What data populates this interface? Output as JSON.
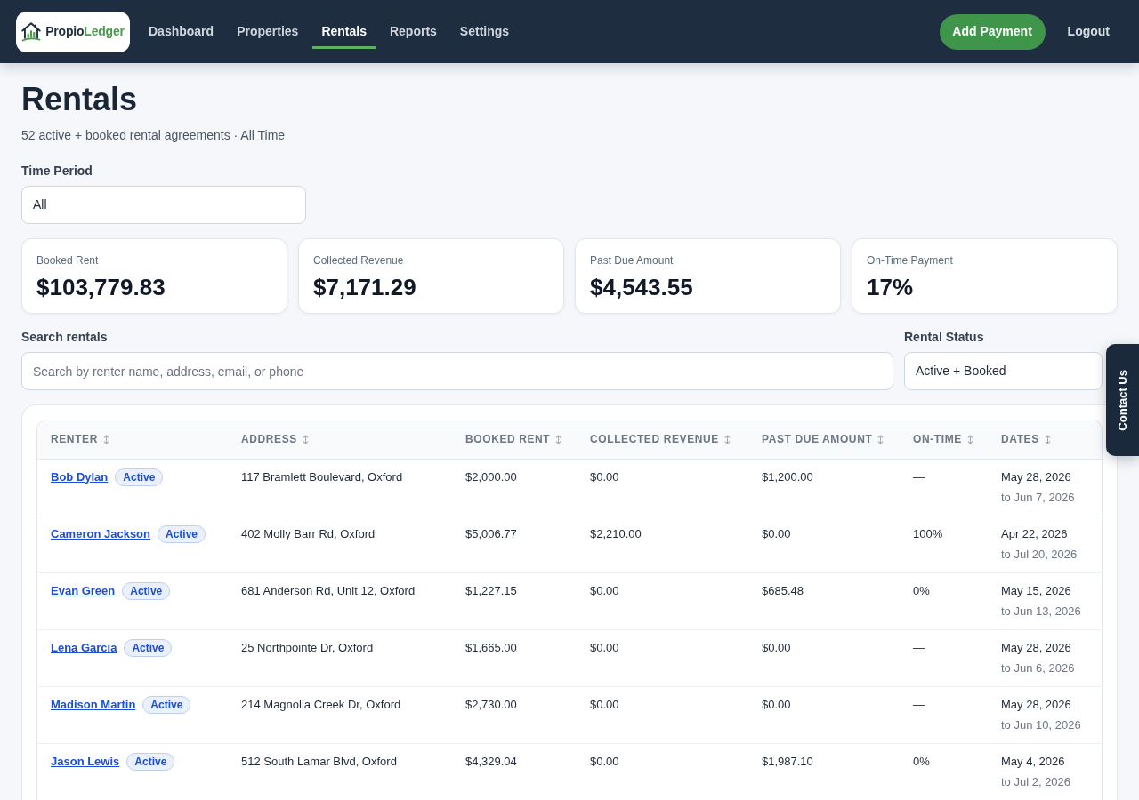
{
  "brand": {
    "name_parts": [
      {
        "text": "Propio",
        "color": "#1f2d3d"
      },
      {
        "text": "Ledger",
        "color": "#4b9b4f"
      }
    ]
  },
  "nav": {
    "items": [
      {
        "label": "Dashboard",
        "selected": false
      },
      {
        "label": "Properties",
        "selected": false
      },
      {
        "label": "Rentals",
        "selected": true
      },
      {
        "label": "Reports",
        "selected": false
      },
      {
        "label": "Settings",
        "selected": false
      }
    ],
    "add_payment_button": "Add Payment",
    "logout": "Logout"
  },
  "page": {
    "title": "Rentals",
    "subtitle": "52 active + booked rental agreements · All Time"
  },
  "time_period": {
    "label": "Time Period",
    "value": "All"
  },
  "stats": [
    {
      "label": "Booked Rent",
      "value": "$103,779.83"
    },
    {
      "label": "Collected Revenue",
      "value": "$7,171.29"
    },
    {
      "label": "Past Due Amount",
      "value": "$4,543.55"
    },
    {
      "label": "On-Time Payment",
      "value": "17%"
    }
  ],
  "search": {
    "label": "Search rentals",
    "placeholder": "Search by renter name, address, email, or phone"
  },
  "rental_status": {
    "label": "Rental Status",
    "value": "Active + Booked"
  },
  "table": {
    "columns": [
      {
        "label": "RENTER"
      },
      {
        "label": "ADDRESS"
      },
      {
        "label": "BOOKED RENT"
      },
      {
        "label": "COLLECTED REVENUE"
      },
      {
        "label": "PAST DUE AMOUNT"
      },
      {
        "label": "ON-TIME"
      },
      {
        "label": "DATES"
      }
    ],
    "rows": [
      {
        "renter": "Bob Dylan",
        "status": "Active",
        "address": "117 Bramlett Boulevard, Oxford",
        "booked_rent": "$2,000.00",
        "collected_revenue": "$0.00",
        "past_due_amount": "$1,200.00",
        "on_time": "—",
        "date_start": "May 28, 2026",
        "date_end": "to Jun 7, 2026"
      },
      {
        "renter": "Cameron Jackson",
        "status": "Active",
        "address": "402 Molly Barr Rd, Oxford",
        "booked_rent": "$5,006.77",
        "collected_revenue": "$2,210.00",
        "past_due_amount": "$0.00",
        "on_time": "100%",
        "date_start": "Apr 22, 2026",
        "date_end": "to Jul 20, 2026"
      },
      {
        "renter": "Evan Green",
        "status": "Active",
        "address": "681 Anderson Rd, Unit 12, Oxford",
        "booked_rent": "$1,227.15",
        "collected_revenue": "$0.00",
        "past_due_amount": "$685.48",
        "on_time": "0%",
        "date_start": "May 15, 2026",
        "date_end": "to Jun 13, 2026"
      },
      {
        "renter": "Lena Garcia",
        "status": "Active",
        "address": "25 Northpointe Dr, Oxford",
        "booked_rent": "$1,665.00",
        "collected_revenue": "$0.00",
        "past_due_amount": "$0.00",
        "on_time": "—",
        "date_start": "May 28, 2026",
        "date_end": "to Jun 6, 2026"
      },
      {
        "renter": "Madison Martin",
        "status": "Active",
        "address": "214 Magnolia Creek Dr, Oxford",
        "booked_rent": "$2,730.00",
        "collected_revenue": "$0.00",
        "past_due_amount": "$0.00",
        "on_time": "—",
        "date_start": "May 28, 2026",
        "date_end": "to Jun 10, 2026"
      },
      {
        "renter": "Jason Lewis",
        "status": "Active",
        "address": "512 South Lamar Blvd, Oxford",
        "booked_rent": "$4,329.04",
        "collected_revenue": "$0.00",
        "past_due_amount": "$1,987.10",
        "on_time": "0%",
        "date_start": "May 4, 2026",
        "date_end": "to Jul 2, 2026"
      }
    ]
  },
  "contact_tab": {
    "label": "Contact Us"
  }
}
